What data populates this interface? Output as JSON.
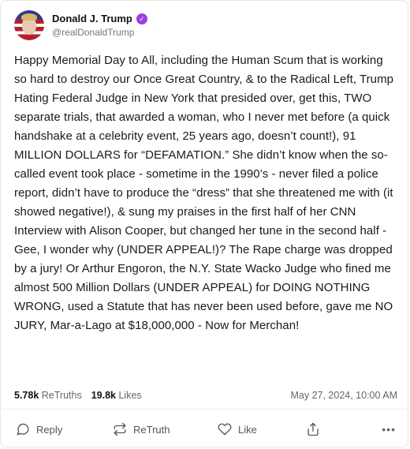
{
  "author": {
    "display_name": "Donald J. Trump",
    "handle": "@realDonaldTrump",
    "verified_icon": "verified-badge-icon"
  },
  "post": {
    "text": "Happy Memorial Day to All, including the Human Scum that is working so hard to destroy our Once Great Country, & to the Radical Left, Trump Hating Federal Judge in New York that presided over, get this, TWO separate trials, that awarded a woman, who I never met before (a quick handshake at a celebrity event, 25 years ago, doesn’t count!), 91 MILLION DOLLARS for “DEFAMATION.” She didn’t know when the so-called event took place - sometime in the 1990’s - never filed a police report, didn’t have to produce the “dress” that she threatened me with (it showed negative!), & sung my praises in the first half of her CNN Interview with Alison Cooper, but changed her tune in the second half - Gee, I wonder why (UNDER APPEAL!)? The Rape charge was dropped by a jury! Or Arthur Engoron, the N.Y. State Wacko Judge who fined me almost 500 Million Dollars (UNDER APPEAL) for DOING NOTHING WRONG, used a Statute that has never been used before, gave me NO JURY, Mar-a-Lago at $18,000,000 - Now for Merchan!"
  },
  "stats": {
    "retruths_count": "5.78k",
    "retruths_label": "ReTruths",
    "likes_count": "19.8k",
    "likes_label": "Likes",
    "timestamp": "May 27, 2024, 10:00 AM"
  },
  "actions": {
    "reply_label": "Reply",
    "retruth_label": "ReTruth",
    "like_label": "Like",
    "share_icon": "share-icon",
    "more_label": "•••"
  },
  "colors": {
    "verified": "#9b3fe0",
    "text": "#1a1a1a",
    "muted": "#666666"
  }
}
